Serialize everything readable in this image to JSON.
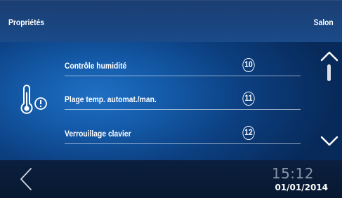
{
  "header": {
    "title": "Propriétés",
    "zone": "Salon"
  },
  "section_icon": "thermometer-alert-icon",
  "items": [
    {
      "label": "Contrôle humidité",
      "number": "10"
    },
    {
      "label": "Plage temp. automat./man.",
      "number": "11"
    },
    {
      "label": "Verrouillage clavier",
      "number": "12"
    }
  ],
  "footer": {
    "back_icon": "back-chevron-icon",
    "time": "15:12",
    "date": "01/01/2014"
  },
  "scroll": {
    "up_icon": "chevron-up-icon",
    "down_icon": "chevron-down-icon"
  },
  "colors": {
    "background": "#145aa8",
    "topbar": "#1a4a88",
    "bottombar": "#0b1f3f",
    "time_text": "#8a96a8"
  }
}
